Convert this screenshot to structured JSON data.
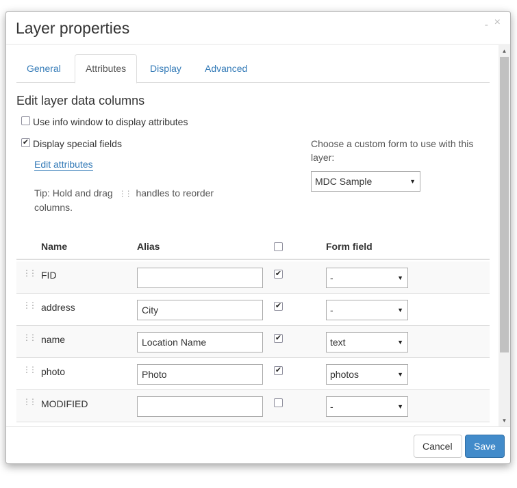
{
  "dialog": {
    "title": "Layer properties",
    "minimize_glyph": "-",
    "close_glyph": "×"
  },
  "tabs": [
    {
      "label": "General"
    },
    {
      "label": "Attributes"
    },
    {
      "label": "Display"
    },
    {
      "label": "Advanced"
    }
  ],
  "active_tab": "Attributes",
  "attributes": {
    "section_title": "Edit layer data columns",
    "use_info_window": {
      "label": "Use info window to display attributes",
      "checked": false
    },
    "display_special_fields": {
      "label": "Display special fields",
      "checked": true
    },
    "edit_attributes_link": "Edit attributes",
    "tip_before": "Tip: Hold and drag",
    "tip_after": "handles to reorder columns.",
    "custom_form_label": "Choose a custom form to use with this layer:",
    "custom_form_value": "MDC Sample"
  },
  "table": {
    "headers": {
      "name": "Name",
      "alias": "Alias",
      "form_field": "Form field"
    },
    "select_all_checked": false,
    "rows": [
      {
        "name": "FID",
        "alias": "",
        "visible": true,
        "form_field": "-"
      },
      {
        "name": "address",
        "alias": "City",
        "visible": true,
        "form_field": "-"
      },
      {
        "name": "name",
        "alias": "Location Name",
        "visible": true,
        "form_field": "text"
      },
      {
        "name": "photo",
        "alias": "Photo",
        "visible": true,
        "form_field": "photos"
      },
      {
        "name": "MODIFIED",
        "alias": "",
        "visible": false,
        "form_field": "-"
      }
    ]
  },
  "footer": {
    "cancel_label": "Cancel",
    "save_label": "Save"
  },
  "colors": {
    "link": "#337ab7",
    "primary_button": "#428bca",
    "border": "#dddddd",
    "striped_row": "#f9f9f9"
  },
  "icons": {
    "drag_handle": "drag-handle-icon",
    "dropdown": "chevron-down-icon",
    "close": "close-icon",
    "minimize": "minimize-icon"
  }
}
